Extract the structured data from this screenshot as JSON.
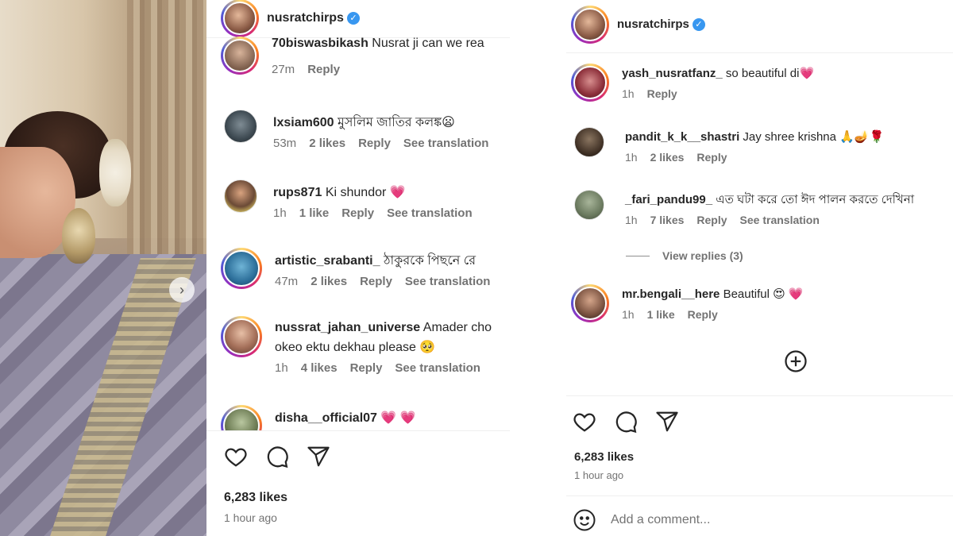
{
  "left": {
    "username": "nusratchirps",
    "comments": [
      {
        "user": "70biswasbikash",
        "text": "Nusrat ji can we rea",
        "time": "27m",
        "likes": "",
        "reply": "Reply",
        "translation": ""
      },
      {
        "user": "lxsiam600",
        "text": "মুসলিম জাতির কলঙ্ক😦",
        "time": "53m",
        "likes": "2 likes",
        "reply": "Reply",
        "translation": "See translation"
      },
      {
        "user": "rups871",
        "text": "Ki shundor 💗",
        "time": "1h",
        "likes": "1 like",
        "reply": "Reply",
        "translation": "See translation"
      },
      {
        "user": "artistic_srabanti_",
        "text": "ঠাকুরকে পিছনে রে",
        "time": "47m",
        "likes": "2 likes",
        "reply": "Reply",
        "translation": "See translation"
      },
      {
        "user": "nussrat_jahan_universe",
        "text": "Amader cho",
        "text2": "okeo ektu dekhau please 🥺",
        "time": "1h",
        "likes": "4 likes",
        "reply": "Reply",
        "translation": "See translation"
      },
      {
        "user": "disha__official07",
        "text": "💗 💗"
      }
    ],
    "likes": "6,283 likes",
    "ago": "1 hour ago"
  },
  "right": {
    "username": "nusratchirps",
    "comments": [
      {
        "user": "yash_nusratfanz_",
        "text": "so beautiful di💗",
        "time": "1h",
        "likes": "",
        "reply": "Reply",
        "translation": ""
      },
      {
        "user": "pandit_k_k__shastri",
        "text": "Jay shree krishna 🙏🪔🌹",
        "time": "1h",
        "likes": "2 likes",
        "reply": "Reply",
        "translation": ""
      },
      {
        "user": "_fari_pandu99_",
        "text": "এত ঘটা করে তো ঈদ পালন করতে দেখিনা",
        "time": "1h",
        "likes": "7 likes",
        "reply": "Reply",
        "translation": "See translation"
      },
      {
        "user": "mr.bengali__here",
        "text": "Beautiful 😍 💗",
        "time": "1h",
        "likes": "1 like",
        "reply": "Reply",
        "translation": ""
      }
    ],
    "view_replies": "View replies (3)",
    "likes": "6,283 likes",
    "ago": "1 hour ago",
    "add_comment_placeholder": "Add a comment..."
  },
  "colors": {
    "verified": "#3897f0",
    "heart": "#ed4956",
    "muted": "#737373",
    "text": "#262626"
  },
  "icons": [
    "chevron-right-icon",
    "verified-badge-icon",
    "heart-icon",
    "comment-icon",
    "share-icon",
    "plus-circle-icon",
    "emoji-icon"
  ]
}
